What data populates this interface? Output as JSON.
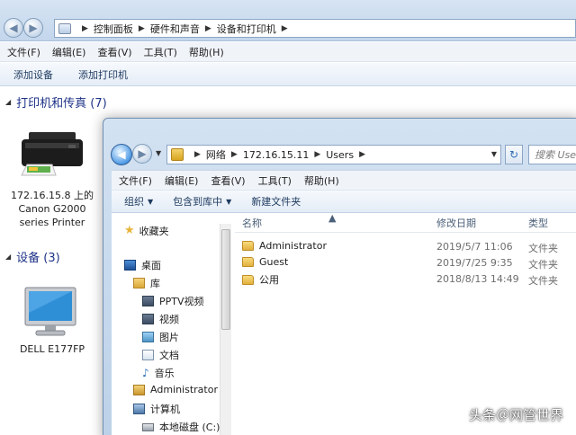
{
  "background_window": {
    "breadcrumb": [
      "控制面板",
      "硬件和声音",
      "设备和打印机"
    ],
    "menu": [
      "文件(F)",
      "编辑(E)",
      "查看(V)",
      "工具(T)",
      "帮助(H)"
    ],
    "commands": [
      "添加设备",
      "添加打印机"
    ],
    "printers_group": "打印机和传真 (7)",
    "printer_label": [
      "172.16.15.8 上的",
      "Canon G2000",
      "series Printer"
    ],
    "devices_group": "设备 (3)",
    "monitor_label": "DELL E177FP"
  },
  "explorer": {
    "breadcrumb": [
      "网络",
      "172.16.15.11",
      "Users"
    ],
    "search_placeholder": "搜索 Users",
    "menu": [
      "文件(F)",
      "编辑(E)",
      "查看(V)",
      "工具(T)",
      "帮助(H)"
    ],
    "commands": {
      "organize": "组织",
      "include_library": "包含到库中",
      "new_folder": "新建文件夹"
    },
    "nav": {
      "favorites": "收藏夹",
      "desktop": "桌面",
      "libraries": "库",
      "pptv": "PPTV视频",
      "videos": "视频",
      "pictures": "图片",
      "documents": "文档",
      "music": "音乐",
      "administrator": "Administrator",
      "computer": "计算机",
      "local_disk": "本地磁盘 (C:)"
    },
    "columns": {
      "name": "名称",
      "date": "修改日期",
      "type": "类型"
    },
    "files": [
      {
        "name": "Administrator",
        "date": "2019/5/7 11:06",
        "type": "文件夹"
      },
      {
        "name": "Guest",
        "date": "2019/7/25 9:35",
        "type": "文件夹"
      },
      {
        "name": "公用",
        "date": "2018/8/13 14:49",
        "type": "文件夹"
      }
    ]
  },
  "watermark": "头条＠网管世界"
}
